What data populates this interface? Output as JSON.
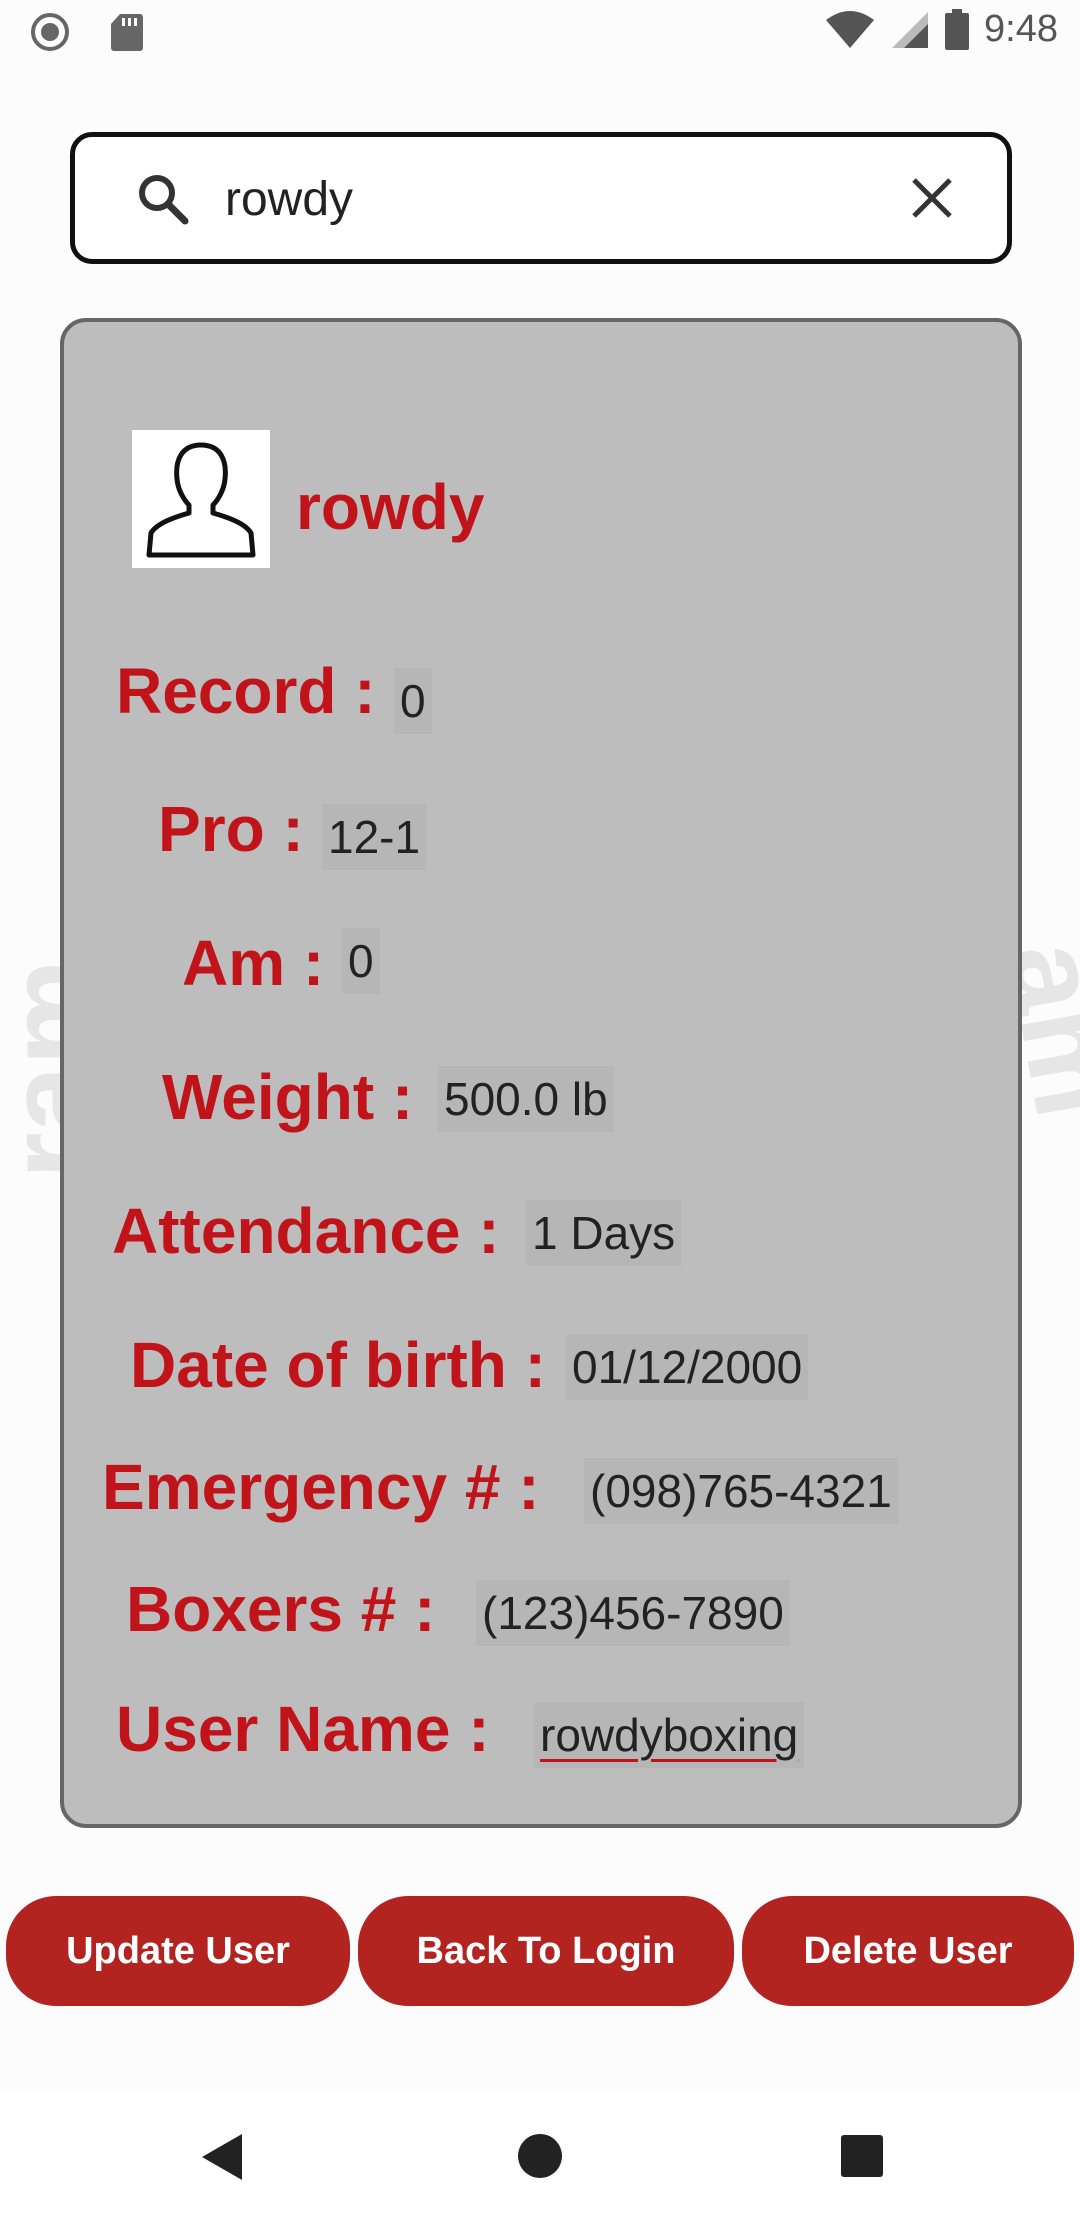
{
  "status_bar": {
    "time": "9:48",
    "icons": [
      "record-icon",
      "sd-card-icon",
      "wifi-icon",
      "signal-icon",
      "battery-icon"
    ]
  },
  "search": {
    "value": "rowdy",
    "icons": [
      "search-icon",
      "close-icon"
    ]
  },
  "profile": {
    "avatar_icon": "user-silhouette-icon",
    "name": "rowdy",
    "fields": [
      {
        "label": "Record :",
        "value": "0"
      },
      {
        "label": "Pro :",
        "value": "12-1"
      },
      {
        "label": "Am :",
        "value": "0"
      },
      {
        "label": "Weight :",
        "value": "500.0 lb"
      },
      {
        "label": "Attendance :",
        "value": "1 Days"
      },
      {
        "label": "Date of birth :",
        "value": "01/12/2000"
      },
      {
        "label": "Emergency # :",
        "value": "(098)765-4321"
      },
      {
        "label": "Boxers # :",
        "value": "(123)456-7890"
      },
      {
        "label": "User Name :",
        "value": "rowdyboxing"
      }
    ]
  },
  "actions": {
    "update": "Update User",
    "back": "Back To Login",
    "delete": "Delete User"
  },
  "colors": {
    "accent_red": "#c0141a",
    "button_red": "#b3231f",
    "card_bg": "#bdbdbd"
  },
  "nav_bar": {
    "icons": [
      "back-triangle-icon",
      "home-circle-icon",
      "recents-square-icon"
    ]
  }
}
